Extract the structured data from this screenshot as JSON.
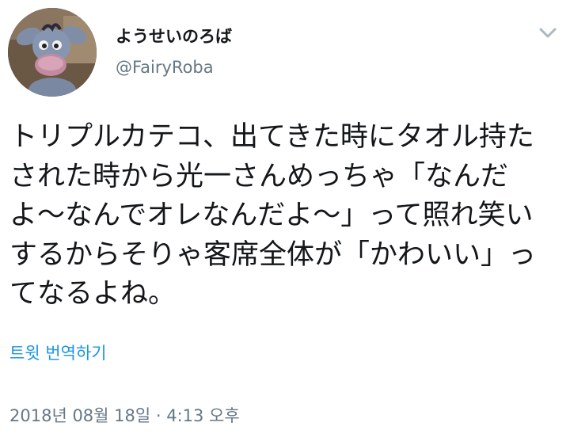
{
  "author": {
    "display_name": "ようせいのろば",
    "handle": "@FairyRoba",
    "avatar_icon": "eeyore-plush-avatar"
  },
  "menu": {
    "icon": "chevron-down-icon"
  },
  "tweet": {
    "text": "トリプルカテコ、出てきた時にタオル持た\nされた時から光一さんめっちゃ「なんだ\nよ〜なんでオレなんだよ〜」って照れ笑い\nするからそりゃ客席全体が「かわいい」っ\nてなるよね。",
    "translate_label": "트윗 번역하기",
    "timestamp": "2018년 08월 18일 · 4:13 오후"
  },
  "colors": {
    "text_primary": "#14171a",
    "text_secondary": "#657786",
    "link": "#1b95e0",
    "background": "#ffffff"
  }
}
